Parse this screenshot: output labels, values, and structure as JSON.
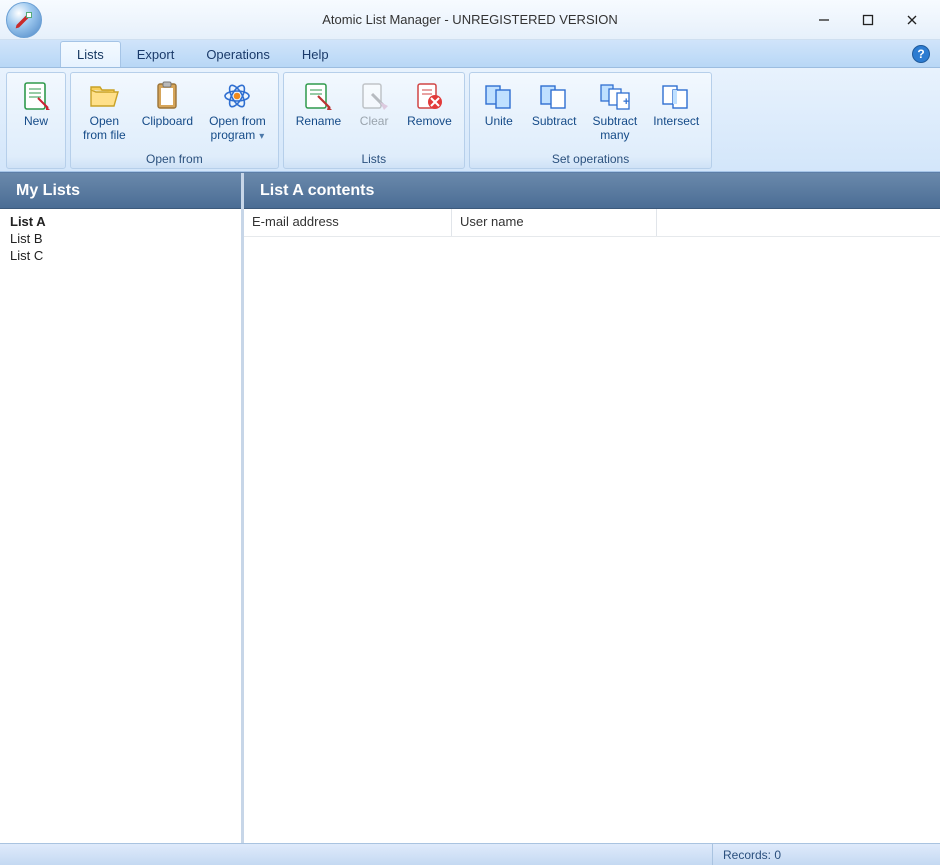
{
  "window": {
    "title": "Atomic List Manager - UNREGISTERED VERSION"
  },
  "tabs": [
    {
      "label": "Lists",
      "active": true
    },
    {
      "label": "Export",
      "active": false
    },
    {
      "label": "Operations",
      "active": false
    },
    {
      "label": "Help",
      "active": false
    }
  ],
  "ribbon": {
    "new_label": "New",
    "group_openfrom": {
      "label": "Open from",
      "open_file": "Open\nfrom file",
      "clipboard": "Clipboard",
      "open_program": "Open from\nprogram"
    },
    "group_lists": {
      "label": "Lists",
      "rename": "Rename",
      "clear": "Clear",
      "remove": "Remove"
    },
    "group_setops": {
      "label": "Set operations",
      "unite": "Unite",
      "subtract": "Subtract",
      "subtract_many": "Subtract\nmany",
      "intersect": "Intersect"
    }
  },
  "sidebar": {
    "title": "My Lists",
    "items": [
      {
        "label": "List A",
        "selected": true
      },
      {
        "label": "List B",
        "selected": false
      },
      {
        "label": "List C",
        "selected": false
      }
    ]
  },
  "content": {
    "title": "List A contents",
    "columns": [
      "E-mail address",
      "User name"
    ]
  },
  "statusbar": {
    "records_label": "Records: 0"
  }
}
